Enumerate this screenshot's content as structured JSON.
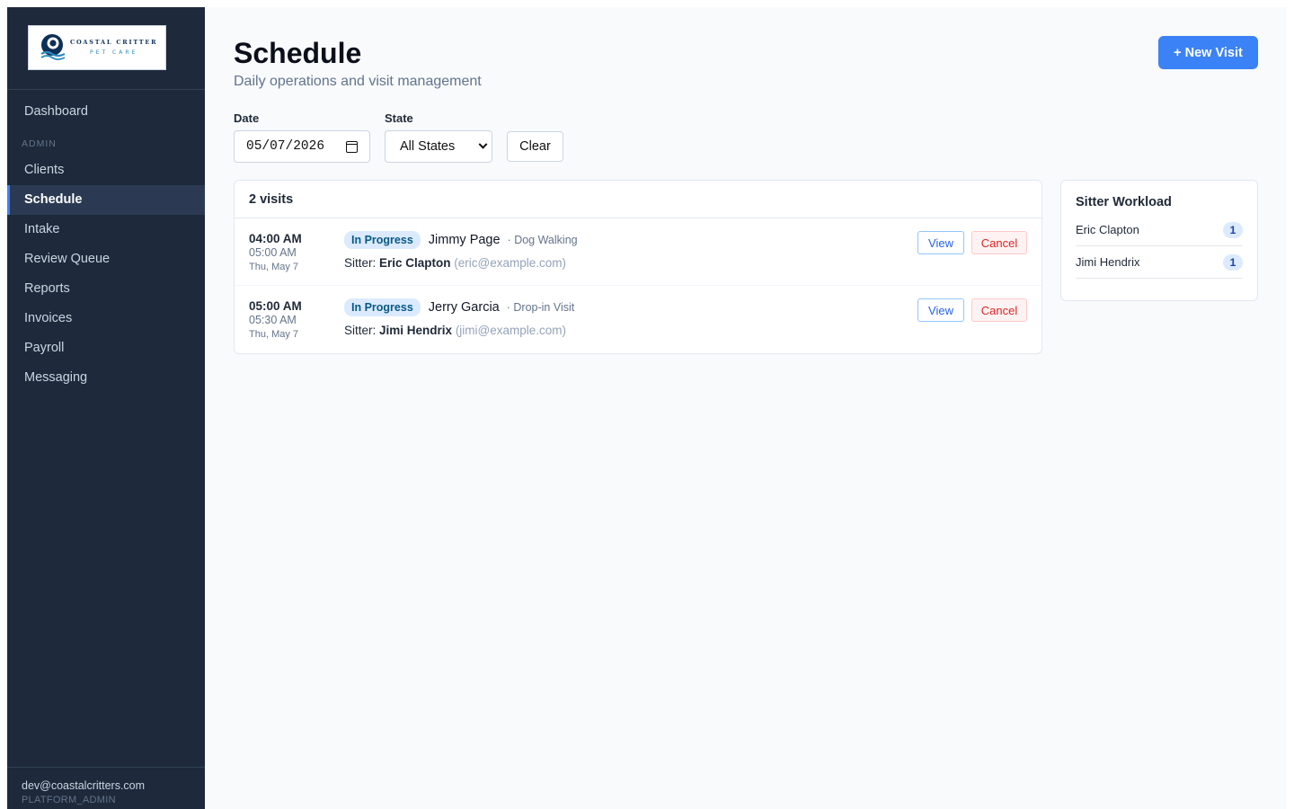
{
  "brand": {
    "logo_line1": "COASTAL CRITTER",
    "logo_line2": "PET CARE"
  },
  "sidebar": {
    "items_top": [
      {
        "label": "Dashboard",
        "key": "dashboard"
      }
    ],
    "section_label": "ADMIN",
    "items": [
      {
        "label": "Clients",
        "key": "clients"
      },
      {
        "label": "Schedule",
        "key": "schedule",
        "active": true
      },
      {
        "label": "Intake",
        "key": "intake"
      },
      {
        "label": "Review Queue",
        "key": "review-queue"
      },
      {
        "label": "Reports",
        "key": "reports"
      },
      {
        "label": "Invoices",
        "key": "invoices"
      },
      {
        "label": "Payroll",
        "key": "payroll"
      },
      {
        "label": "Messaging",
        "key": "messaging"
      }
    ],
    "user_email": "dev@coastalcritters.com",
    "user_role": "PLATFORM_ADMIN"
  },
  "header": {
    "title": "Schedule",
    "subtitle": "Daily operations and visit management",
    "new_visit_label": "+ New Visit"
  },
  "filters": {
    "date_label": "Date",
    "date_value": "05/07/2026",
    "state_label": "State",
    "state_value": "All States",
    "clear_label": "Clear"
  },
  "visits": {
    "count_label": "2 visits",
    "rows": [
      {
        "start": "04:00 AM",
        "end": "05:00 AM",
        "date": "Thu, May 7",
        "status": "In Progress",
        "client": "Jimmy Page",
        "service": "· Dog Walking",
        "sitter_prefix": "Sitter: ",
        "sitter": "Eric Clapton",
        "sitter_email": "(eric@example.com)",
        "view_label": "View",
        "cancel_label": "Cancel"
      },
      {
        "start": "05:00 AM",
        "end": "05:30 AM",
        "date": "Thu, May 7",
        "status": "In Progress",
        "client": "Jerry Garcia",
        "service": "· Drop-in Visit",
        "sitter_prefix": "Sitter: ",
        "sitter": "Jimi Hendrix",
        "sitter_email": "(jimi@example.com)",
        "view_label": "View",
        "cancel_label": "Cancel"
      }
    ]
  },
  "workload": {
    "title": "Sitter Workload",
    "items": [
      {
        "name": "Eric Clapton",
        "count": "1"
      },
      {
        "name": "Jimi Hendrix",
        "count": "1"
      }
    ]
  },
  "colors": {
    "sidebar_bg": "#1e293b",
    "accent": "#3b82f6",
    "status_badge_bg": "#dbeafe",
    "cancel_red": "#dc2626"
  },
  "icons": [
    "logo-icon",
    "calendar-icon",
    "chevron-down-icon"
  ]
}
